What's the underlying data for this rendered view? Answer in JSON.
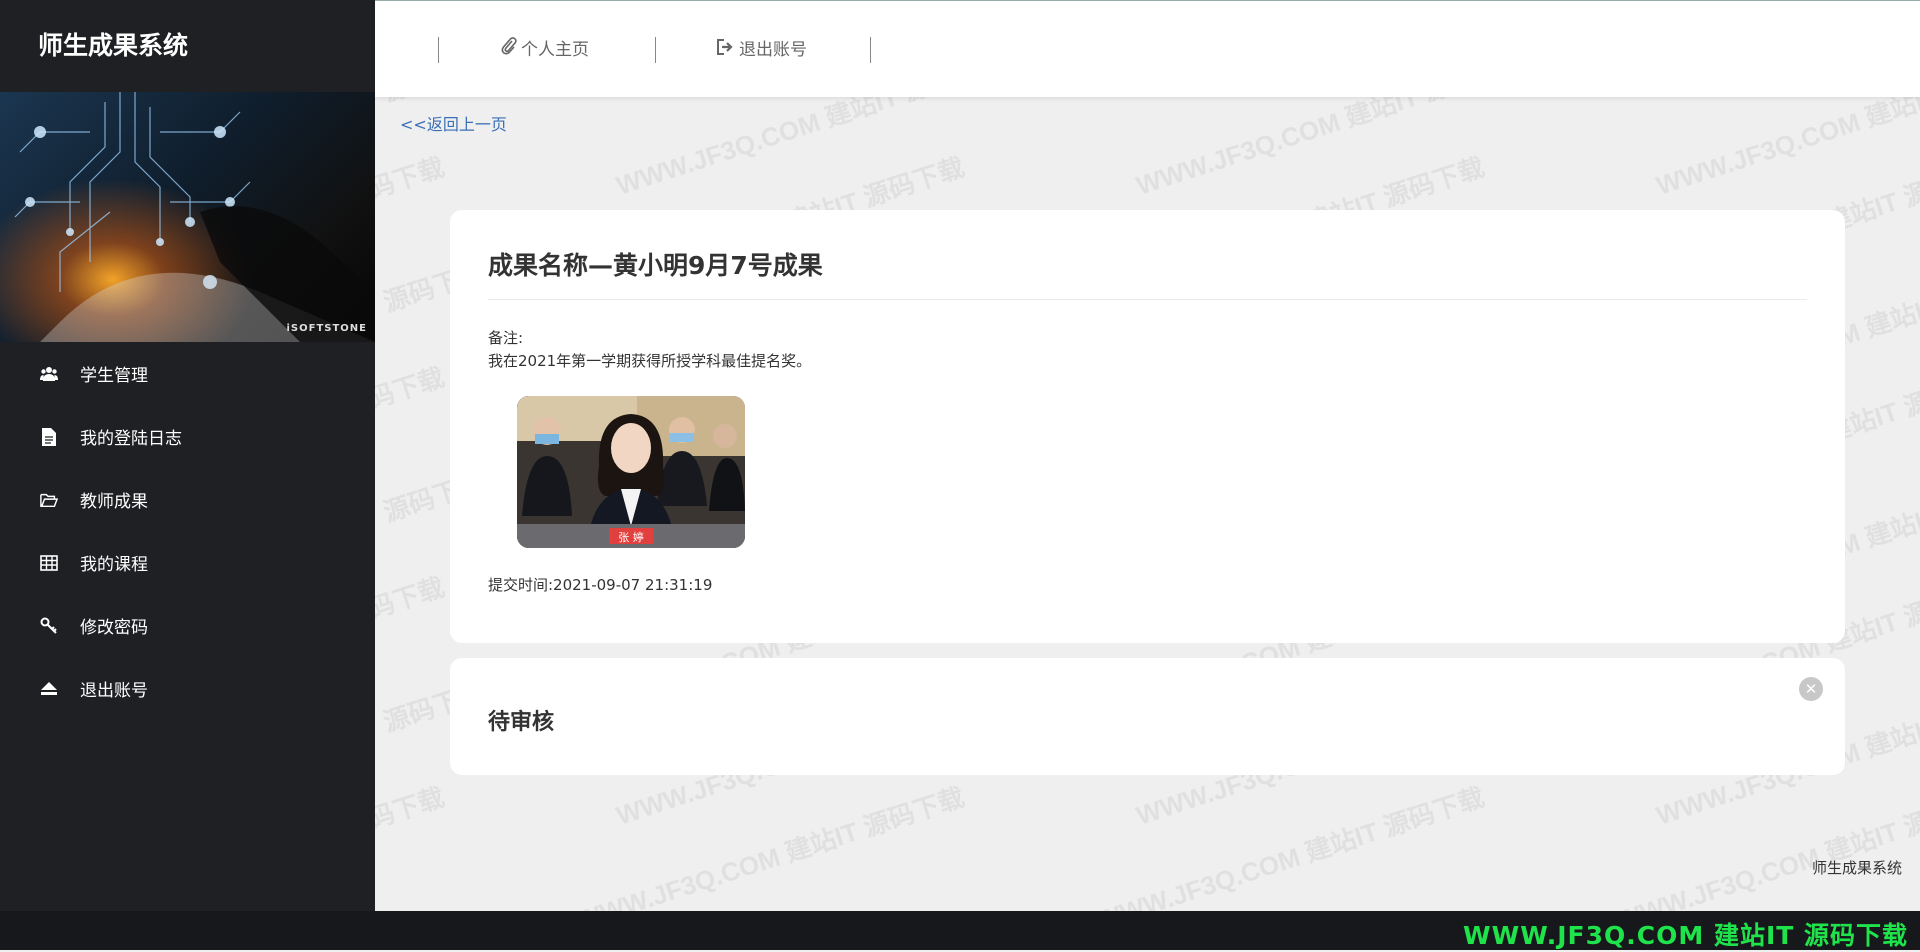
{
  "app": {
    "title": "师生成果系统",
    "banner_mark": "iSOFTSTONE"
  },
  "sidebar": {
    "items": [
      {
        "label": "学生管理",
        "icon": "users-icon"
      },
      {
        "label": "我的登陆日志",
        "icon": "document-icon"
      },
      {
        "label": "教师成果",
        "icon": "folder-open-icon"
      },
      {
        "label": "我的课程",
        "icon": "table-icon"
      },
      {
        "label": "修改密码",
        "icon": "key-icon"
      },
      {
        "label": "退出账号",
        "icon": "eject-icon"
      }
    ]
  },
  "topbar": {
    "profile_label": "个人主页",
    "logout_label": "退出账号"
  },
  "back_link": "<<返回上一页",
  "achievement": {
    "title": "成果名称—黄小明9月7号成果",
    "remark_label": "备注:",
    "remark_text": "我在2021年第一学期获得所授学科最佳提名奖。",
    "photo_caption": "张 婷",
    "submit_time": "提交时间:2021-09-07 21:31:19"
  },
  "review": {
    "status": "待审核"
  },
  "footer": {
    "system_name": "师生成果系统"
  },
  "watermark": {
    "text": "WWW.JF3Q.COM 建站IT  源码下载"
  },
  "colors": {
    "sidebar_bg": "#1e2024",
    "link": "#3b6fb5",
    "watermark_green": "#1fe34a"
  }
}
